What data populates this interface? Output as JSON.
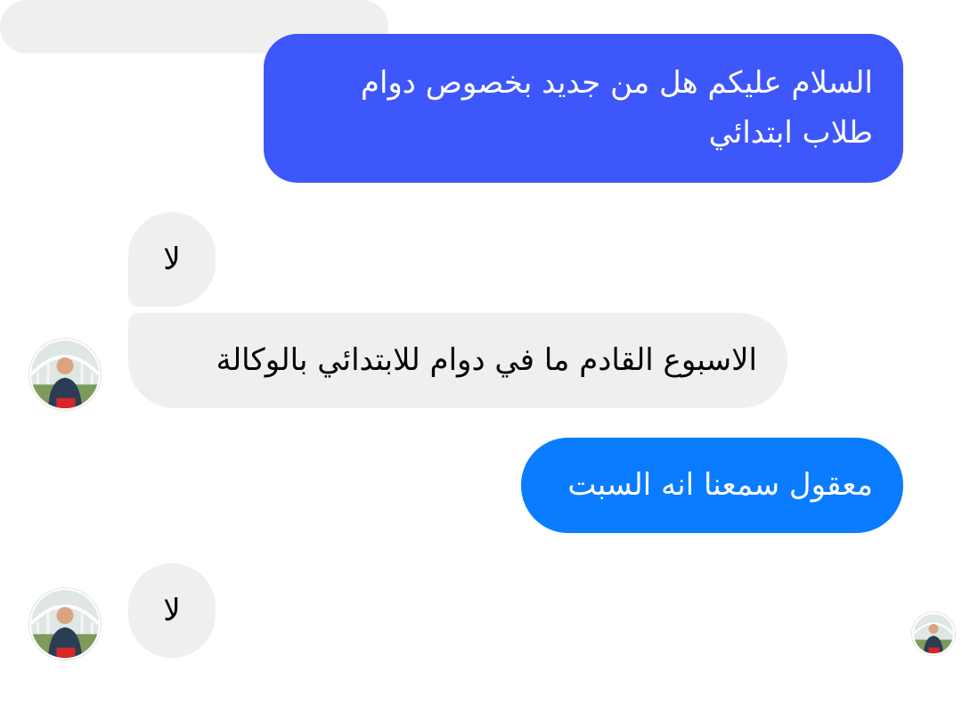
{
  "messages": [
    {
      "direction": "outgoing",
      "text_line1": "السلام عليكم هل من جديد بخصوص دوام",
      "text_line2": "طلاب ابتدائي"
    },
    {
      "direction": "incoming",
      "text": "لا"
    },
    {
      "direction": "incoming",
      "text": "الاسبوع القادم ما في دوام للابتدائي بالوكالة"
    },
    {
      "direction": "outgoing",
      "text": "معقول سمعنا انه السبت"
    },
    {
      "direction": "incoming",
      "text": "لا"
    }
  ],
  "colors": {
    "outgoing_primary": "#3d57fb",
    "outgoing_secondary": "#0a7cff",
    "incoming_bubble": "#efefef",
    "background": "#ffffff"
  },
  "icons": {
    "contact_avatar": "contact-avatar-icon",
    "read_receipt": "read-receipt-avatar-icon"
  }
}
